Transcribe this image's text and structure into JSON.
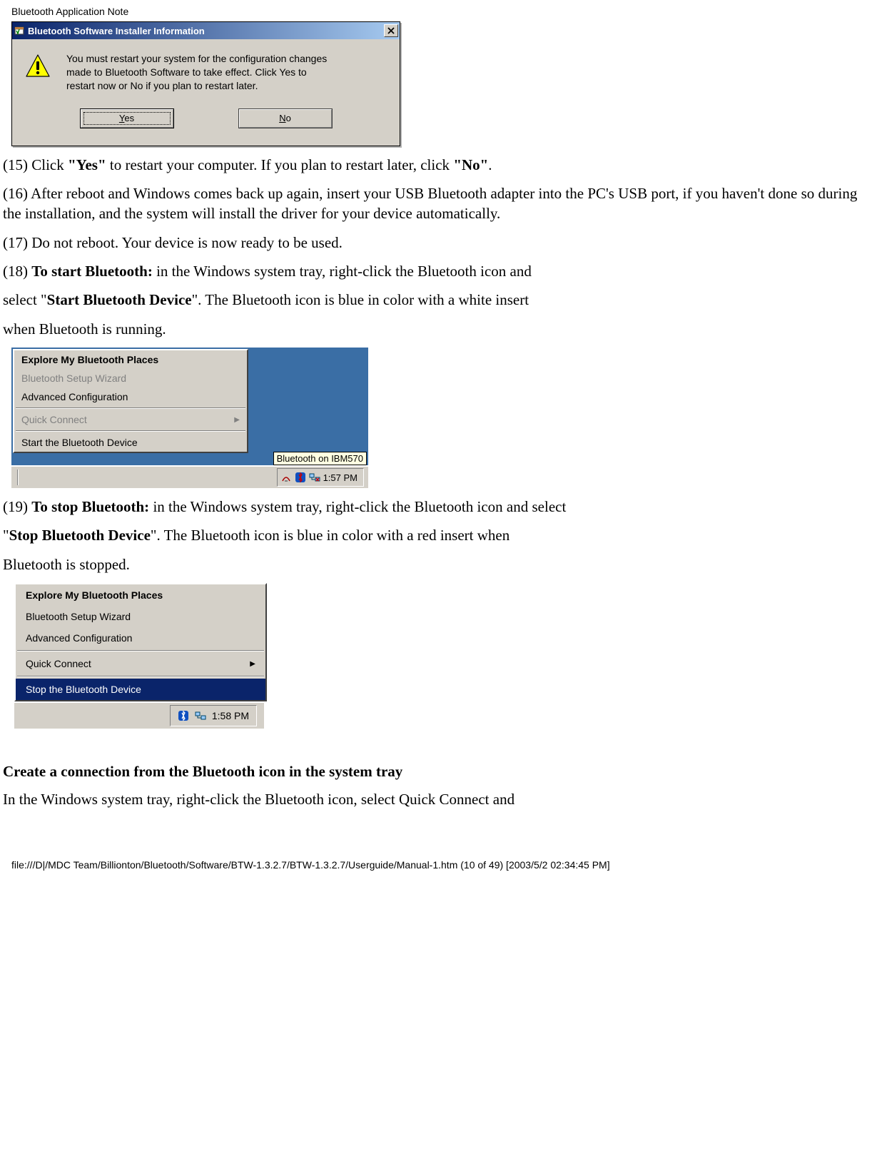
{
  "page_header": "Bluetooth Application Note",
  "dialog": {
    "title": "Bluetooth Software Installer Information",
    "body": "You must restart your system for the configuration changes made to Bluetooth Software to take effect. Click Yes to restart now or No if you plan to restart later.",
    "yes": "Yes",
    "no": "No"
  },
  "para15_prefix": "(15) Click ",
  "para15_yes": "\"Yes\"",
  "para15_mid": " to restart your computer. If you plan to restart later, click ",
  "para15_no": "\"No\"",
  "para15_suffix": ".",
  "para16": "(16) After reboot and Windows comes back up again, insert your USB Bluetooth adapter into the PC's USB port, if you haven't done so during the installation, and the system will install the driver for your device automatically.",
  "para17": "(17) Do not reboot. Your device is now ready to be used.",
  "para18_prefix": "(18) ",
  "para18_bold": "To start Bluetooth:",
  "para18_suffix": " in the Windows system tray, right-click the Bluetooth icon and",
  "para18b_prefix": "select \"",
  "para18b_bold": "Start Bluetooth Device",
  "para18b_suffix": "\". The Bluetooth icon is blue in color with a white insert",
  "para18c": "when Bluetooth is running.",
  "menu1": {
    "items": [
      {
        "label": "Explore My Bluetooth Places",
        "state": "bold"
      },
      {
        "label": "Bluetooth Setup Wizard",
        "state": "disabled"
      },
      {
        "label": "Advanced Configuration",
        "state": "normal"
      },
      {
        "label": "Quick Connect",
        "state": "disabled",
        "submenu": true
      },
      {
        "label": "Start the Bluetooth Device",
        "state": "normal"
      }
    ],
    "tooltip": "Bluetooth on IBM570",
    "time": "1:57 PM"
  },
  "para19_prefix": "(19) ",
  "para19_bold": "To stop Bluetooth:",
  "para19_suffix": " in the Windows system tray, right-click the Bluetooth icon and select",
  "para19b_prefix": "\"",
  "para19b_bold": "Stop Bluetooth Device",
  "para19b_suffix": "\". The Bluetooth icon is blue in color with a red insert when",
  "para19c": "Bluetooth is stopped.",
  "menu2": {
    "items": [
      {
        "label": "Explore My Bluetooth Places",
        "state": "bold"
      },
      {
        "label": "Bluetooth Setup Wizard",
        "state": "normal"
      },
      {
        "label": "Advanced Configuration",
        "state": "normal"
      },
      {
        "label": "Quick Connect",
        "state": "normal",
        "submenu": true
      },
      {
        "label": "Stop the Bluetooth Device",
        "state": "selected"
      }
    ],
    "time": "1:58 PM"
  },
  "section_heading": "Create a connection from the Bluetooth icon in the system tray",
  "section_para": "In the Windows system tray, right-click the Bluetooth icon, select Quick Connect and",
  "footer": "file:///D|/MDC Team/Billionton/Bluetooth/Software/BTW-1.3.2.7/BTW-1.3.2.7/Userguide/Manual-1.htm (10 of 49) [2003/5/2 02:34:45 PM]"
}
